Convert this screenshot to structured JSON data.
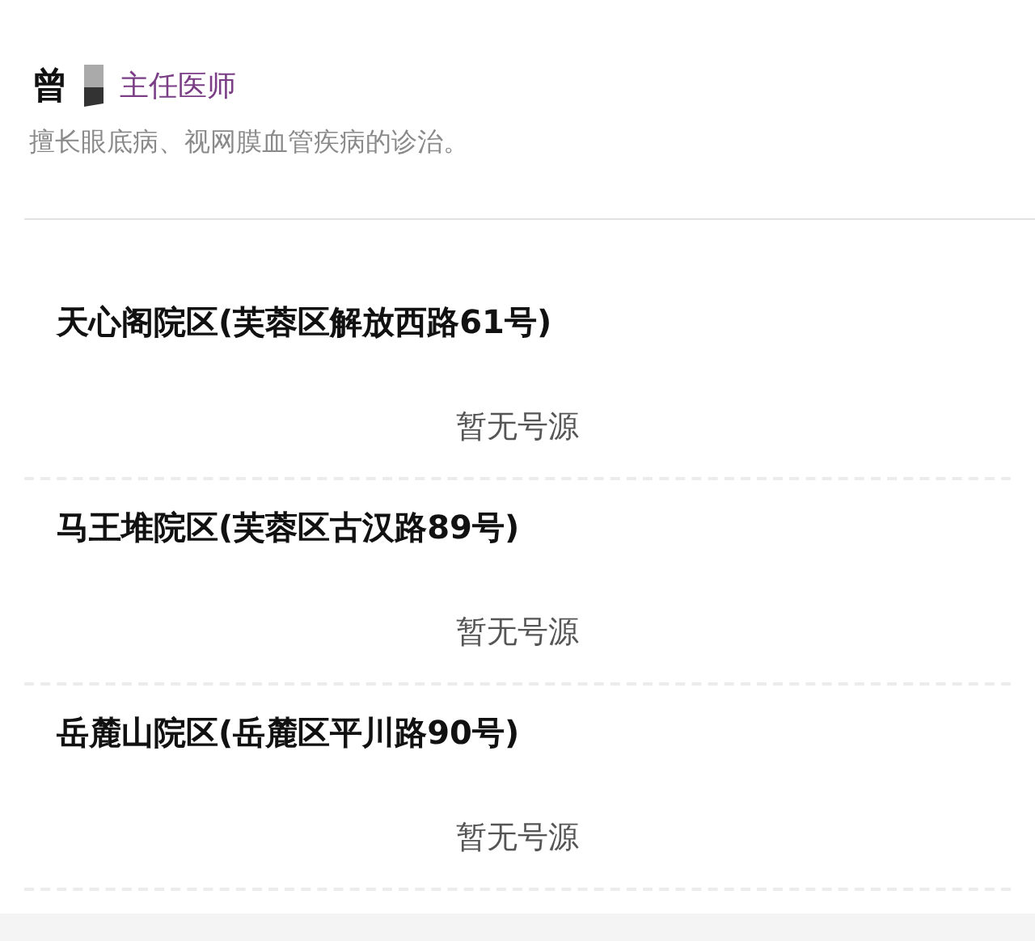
{
  "doctor": {
    "name": "曾",
    "title": "主任医师",
    "description": "擅长眼底病、视网膜血管疾病的诊治。"
  },
  "campuses": [
    {
      "name": "天心阁院区(芙蓉区解放西路61号)",
      "status": "暂无号源"
    },
    {
      "name": "马王堆院区(芙蓉区古汉路89号)",
      "status": "暂无号源"
    },
    {
      "name": "岳麓山院区(岳麓区平川路90号)",
      "status": "暂无号源"
    }
  ]
}
